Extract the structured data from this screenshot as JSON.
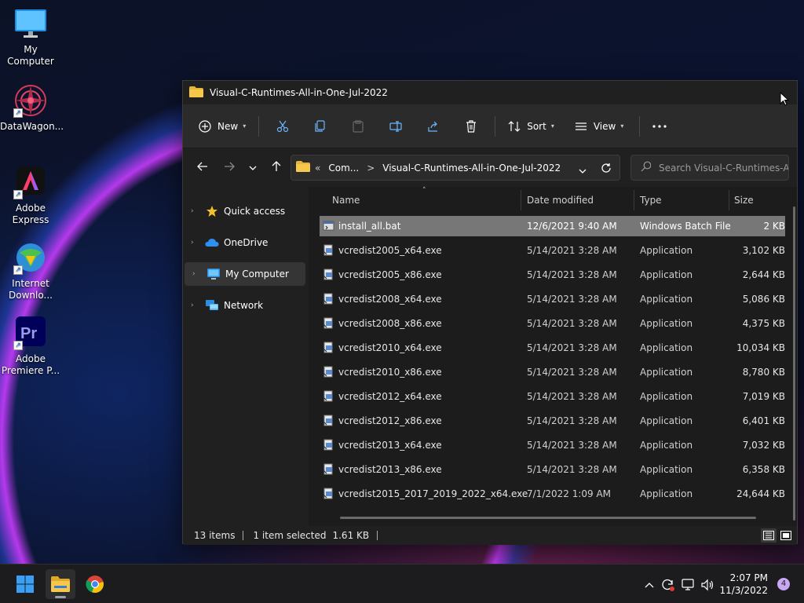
{
  "desktop": {
    "icons": [
      {
        "label": "My Computer",
        "icon": "monitor-icon"
      },
      {
        "label": "DataWagon...",
        "icon": "mandala-icon"
      },
      {
        "label": "Adobe Express",
        "icon": "adobe-express-icon"
      },
      {
        "label": "Internet Downlo...",
        "icon": "idm-icon"
      },
      {
        "label": "Adobe Premiere P...",
        "icon": "premiere-icon"
      }
    ]
  },
  "window": {
    "title": "Visual-C-Runtimes-All-in-One-Jul-2022"
  },
  "toolbar": {
    "new_label": "New",
    "sort_label": "Sort",
    "view_label": "View"
  },
  "address": {
    "overflow": "«",
    "crumb_1": "Com...",
    "separator": ">",
    "crumb_2": "Visual-C-Runtimes-All-in-One-Jul-2022"
  },
  "search": {
    "placeholder": "Search Visual-C-Runtimes-A..."
  },
  "nav": {
    "items": [
      {
        "label": "Quick access",
        "icon": "star-icon"
      },
      {
        "label": "OneDrive",
        "icon": "cloud-icon"
      },
      {
        "label": "My Computer",
        "icon": "monitor-icon"
      },
      {
        "label": "Network",
        "icon": "network-icon"
      }
    ]
  },
  "columns": {
    "name": "Name",
    "date": "Date modified",
    "type": "Type",
    "size": "Size"
  },
  "files": [
    {
      "name": "install_all.bat",
      "date": "12/6/2021 9:40 AM",
      "type": "Windows Batch File",
      "size": "2 KB",
      "selected": true
    },
    {
      "name": "vcredist2005_x64.exe",
      "date": "5/14/2021 3:28 AM",
      "type": "Application",
      "size": "3,102 KB"
    },
    {
      "name": "vcredist2005_x86.exe",
      "date": "5/14/2021 3:28 AM",
      "type": "Application",
      "size": "2,644 KB"
    },
    {
      "name": "vcredist2008_x64.exe",
      "date": "5/14/2021 3:28 AM",
      "type": "Application",
      "size": "5,086 KB"
    },
    {
      "name": "vcredist2008_x86.exe",
      "date": "5/14/2021 3:28 AM",
      "type": "Application",
      "size": "4,375 KB"
    },
    {
      "name": "vcredist2010_x64.exe",
      "date": "5/14/2021 3:28 AM",
      "type": "Application",
      "size": "10,034 KB"
    },
    {
      "name": "vcredist2010_x86.exe",
      "date": "5/14/2021 3:28 AM",
      "type": "Application",
      "size": "8,780 KB"
    },
    {
      "name": "vcredist2012_x64.exe",
      "date": "5/14/2021 3:28 AM",
      "type": "Application",
      "size": "7,019 KB"
    },
    {
      "name": "vcredist2012_x86.exe",
      "date": "5/14/2021 3:28 AM",
      "type": "Application",
      "size": "6,401 KB"
    },
    {
      "name": "vcredist2013_x64.exe",
      "date": "5/14/2021 3:28 AM",
      "type": "Application",
      "size": "7,032 KB"
    },
    {
      "name": "vcredist2013_x86.exe",
      "date": "5/14/2021 3:28 AM",
      "type": "Application",
      "size": "6,358 KB"
    },
    {
      "name": "vcredist2015_2017_2019_2022_x64.exe",
      "date": "7/1/2022 1:09 AM",
      "type": "Application",
      "size": "24,644 KB"
    }
  ],
  "status": {
    "items_count": "13 items",
    "selected": "1 item selected",
    "selected_size": "1.61 KB"
  },
  "taskbar": {
    "time": "2:07 PM",
    "date": "11/3/2022",
    "notification_count": "4"
  },
  "colors": {
    "accent_folder": "#e8b53a",
    "window_bg": "#202020",
    "selected_row": "#777777"
  }
}
